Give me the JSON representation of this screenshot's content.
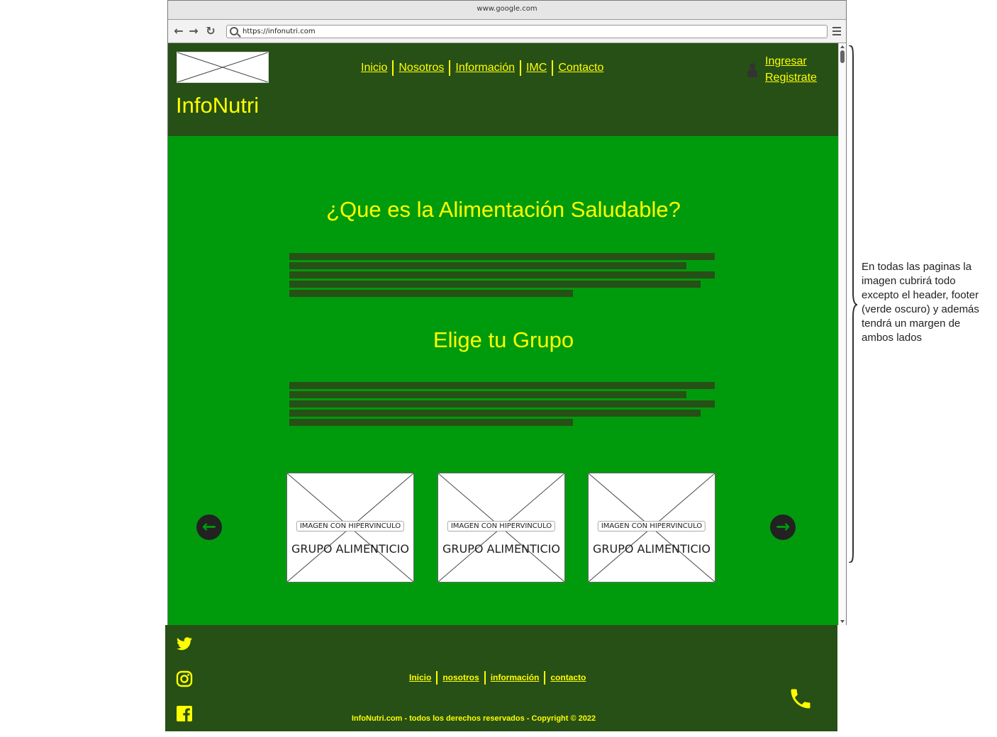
{
  "browser": {
    "title": "www.google.com",
    "url": "https://infonutri.com"
  },
  "header": {
    "site_name": "InfoNutri",
    "nav": [
      "Inicio",
      "Nosotros",
      "Información",
      "IMC",
      "Contacto"
    ],
    "login": "Ingresar",
    "register": "Registrate"
  },
  "main": {
    "heading1": "¿Que es la Alimentación Saludable?",
    "heading2": "Elige tu Grupo",
    "cards": [
      {
        "badge": "IMAGEN CON HIPERVINCULO",
        "caption": "GRUPO ALIMENTICIO"
      },
      {
        "badge": "IMAGEN CON HIPERVINCULO",
        "caption": "GRUPO ALIMENTICIO"
      },
      {
        "badge": "IMAGEN CON HIPERVINCULO",
        "caption": "GRUPO ALIMENTICIO"
      }
    ]
  },
  "footer": {
    "nav": [
      "Inicio",
      "nosotros",
      "información",
      "contacto"
    ],
    "copyright": "InfoNutri.com - todos los derechos reservados - Copyright © 2022",
    "social": [
      "twitter-icon",
      "instagram-icon",
      "facebook-icon"
    ]
  },
  "annotation": "En todas las paginas la imagen cubrirá todo excepto el header, footer (verde oscuro) y además tendrá un margen de ambos lados",
  "colors": {
    "dark_green": "#275016",
    "bright_green": "#009b0d",
    "yellow": "#ffff00"
  }
}
